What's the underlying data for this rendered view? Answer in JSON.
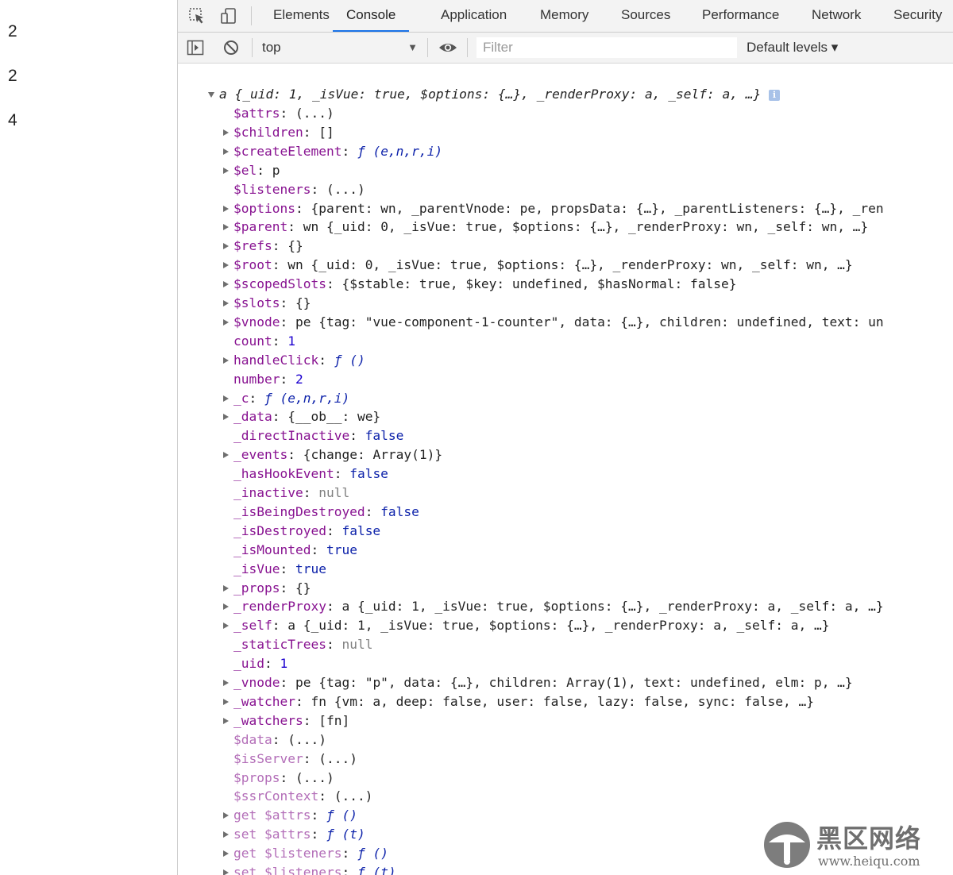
{
  "page_output": {
    "values": [
      "2",
      "2",
      "4"
    ]
  },
  "devtools": {
    "tabs": [
      "Elements",
      "Console",
      "Application",
      "Memory",
      "Sources",
      "Performance",
      "Network",
      "Security"
    ],
    "active_tab": "Console",
    "toolbar": {
      "context": "top",
      "filter_placeholder": "Filter",
      "levels": "Default levels ▾"
    }
  },
  "console": {
    "header": {
      "text": "a {_uid: 1, _isVue: true, $options: {…}, _renderProxy: a, _self: a, …}",
      "info_badge": "i"
    },
    "rows": [
      {
        "key": "$attrs",
        "value": "(...)"
      },
      {
        "key": "$children",
        "value": "[]"
      },
      {
        "key": "$createElement",
        "value": "ƒ (e,n,r,i)"
      },
      {
        "key": "$el",
        "value": "p"
      },
      {
        "key": "$listeners",
        "value": "(...)"
      },
      {
        "key": "$options",
        "value": "{parent: wn, _parentVnode: pe, propsData: {…}, _parentListeners: {…}, _ren"
      },
      {
        "key": "$parent",
        "value": "wn {_uid: 0, _isVue: true, $options: {…}, _renderProxy: wn, _self: wn, …}"
      },
      {
        "key": "$refs",
        "value": "{}"
      },
      {
        "key": "$root",
        "value": "wn {_uid: 0, _isVue: true, $options: {…}, _renderProxy: wn, _self: wn, …}"
      },
      {
        "key": "$scopedSlots",
        "value": "{$stable: true, $key: undefined, $hasNormal: false}"
      },
      {
        "key": "$slots",
        "value": "{}"
      },
      {
        "key": "$vnode",
        "value": "pe {tag: \"vue-component-1-counter\", data: {…}, children: undefined, text: un"
      },
      {
        "key": "count",
        "value": "1"
      },
      {
        "key": "handleClick",
        "value": "ƒ ()"
      },
      {
        "key": "number",
        "value": "2"
      },
      {
        "key": "_c",
        "value": "ƒ (e,n,r,i)"
      },
      {
        "key": "_data",
        "value": "{__ob__: we}"
      },
      {
        "key": "_directInactive",
        "value": "false"
      },
      {
        "key": "_events",
        "value": "{change: Array(1)}"
      },
      {
        "key": "_hasHookEvent",
        "value": "false"
      },
      {
        "key": "_inactive",
        "value": "null"
      },
      {
        "key": "_isBeingDestroyed",
        "value": "false"
      },
      {
        "key": "_isDestroyed",
        "value": "false"
      },
      {
        "key": "_isMounted",
        "value": "true"
      },
      {
        "key": "_isVue",
        "value": "true"
      },
      {
        "key": "_props",
        "value": "{}"
      },
      {
        "key": "_renderProxy",
        "value": "a {_uid: 1, _isVue: true, $options: {…}, _renderProxy: a, _self: a, …}"
      },
      {
        "key": "_self",
        "value": "a {_uid: 1, _isVue: true, $options: {…}, _renderProxy: a, _self: a, …}"
      },
      {
        "key": "_staticTrees",
        "value": "null"
      },
      {
        "key": "_uid",
        "value": "1"
      },
      {
        "key": "_vnode",
        "value": "pe {tag: \"p\", data: {…}, children: Array(1), text: undefined, elm: p, …}"
      },
      {
        "key": "_watcher",
        "value": "fn {vm: a, deep: false, user: false, lazy: false, sync: false, …}"
      },
      {
        "key": "_watchers",
        "value": "[fn]"
      },
      {
        "key": "$data",
        "value": "(...)"
      },
      {
        "key": "$isServer",
        "value": "(...)"
      },
      {
        "key": "$props",
        "value": "(...)"
      },
      {
        "key": "$ssrContext",
        "value": "(...)"
      },
      {
        "key": "get $attrs",
        "value": "ƒ ()"
      },
      {
        "key": "set $attrs",
        "value": "ƒ (t)"
      },
      {
        "key": "get $listeners",
        "value": "ƒ ()"
      },
      {
        "key": "set $listeners",
        "value": "ƒ (t)"
      }
    ]
  },
  "watermark": {
    "cn": "黑区网络",
    "url": "www.heiqu.com"
  },
  "colors": {
    "accent": "#1a73e8",
    "property": "#881391",
    "number": "#1c00cf",
    "string": "#c41a16"
  }
}
